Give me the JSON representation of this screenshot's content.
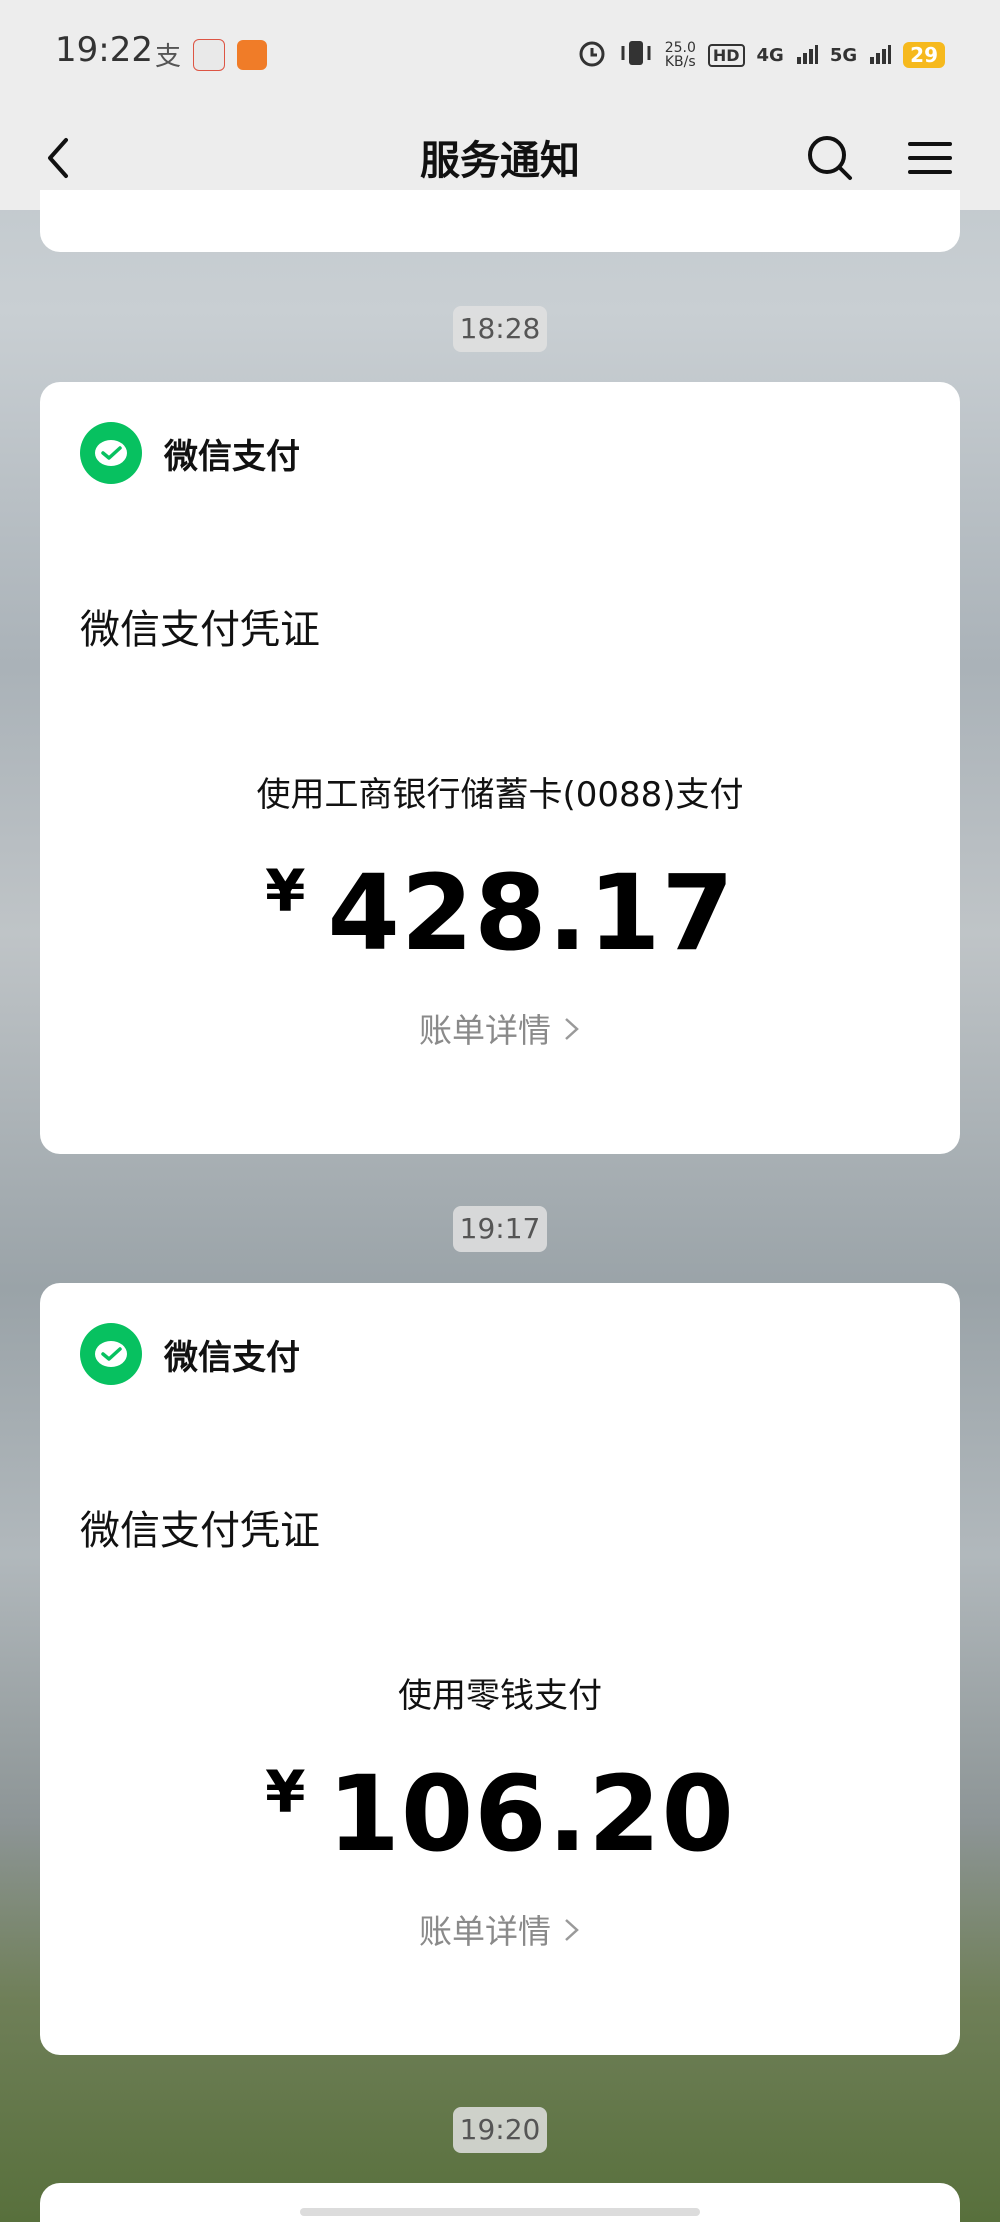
{
  "status_bar": {
    "time": "19:22",
    "net_speed_value": "25.0",
    "net_speed_unit": "KB/s",
    "hd_label": "HD",
    "net_4g": "4G",
    "net_5g": "5G",
    "battery": "29"
  },
  "nav": {
    "title": "服务通知"
  },
  "messages": [
    {
      "time": "18:28",
      "app_name": "微信支付",
      "title": "微信支付凭证",
      "method": "使用工商银行储蓄卡(0088)支付",
      "currency": "¥",
      "amount": "428.17",
      "link": "账单详情"
    },
    {
      "time": "19:17",
      "app_name": "微信支付",
      "title": "微信支付凭证",
      "method": "使用零钱支付",
      "currency": "¥",
      "amount": "106.20",
      "link": "账单详情"
    },
    {
      "time": "19:20"
    }
  ],
  "colors": {
    "wechat_green": "#07c160",
    "bar_bg": "#ededed",
    "battery": "#f6b91d"
  }
}
